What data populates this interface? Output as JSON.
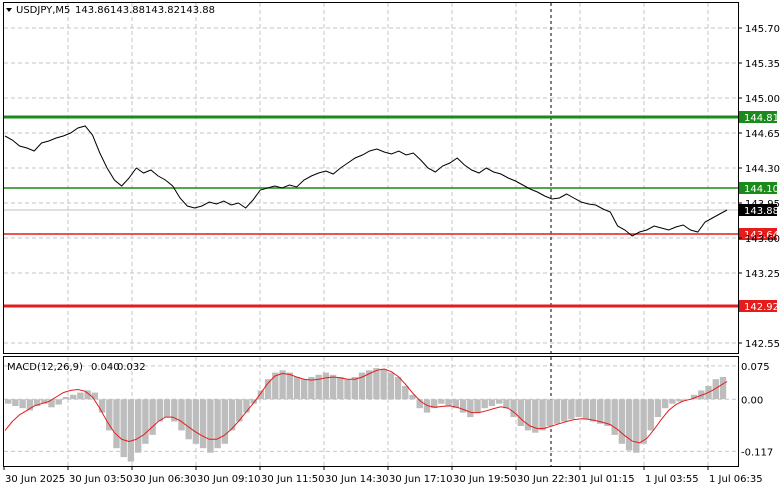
{
  "header": {
    "symbol": "USDJPY,M5",
    "open": "143.86",
    "high": "143.88",
    "low": "143.82",
    "close": "143.88"
  },
  "macd_header": {
    "label": "MACD(12,26,9)",
    "main": "0.040",
    "signal": "0.032"
  },
  "chart_data": [
    {
      "type": "line",
      "name": "price",
      "ylim": [
        142.45,
        145.95
      ],
      "y_ticks": [
        "145.70",
        "145.35",
        "145.00",
        "144.65",
        "144.30",
        "143.95",
        "143.60",
        "143.25",
        "142.55"
      ],
      "x_ticks": [
        "30 Jun 2025",
        "30 Jun 03:50",
        "30 Jun 06:30",
        "30 Jun 09:10",
        "30 Jun 11:50",
        "30 Jun 14:30",
        "30 Jun 17:10",
        "30 Jun 19:50",
        "30 Jun 22:30",
        "1 Jul 01:15",
        "1 Jul 03:55",
        "1 Jul 06:35"
      ],
      "values": [
        144.62,
        144.58,
        144.52,
        144.5,
        144.47,
        144.55,
        144.57,
        144.6,
        144.62,
        144.65,
        144.7,
        144.72,
        144.63,
        144.45,
        144.3,
        144.18,
        144.12,
        144.2,
        144.3,
        144.25,
        144.28,
        144.22,
        144.18,
        144.12,
        144.0,
        143.92,
        143.9,
        143.92,
        143.96,
        143.94,
        143.97,
        143.93,
        143.95,
        143.9,
        143.98,
        144.08,
        144.1,
        144.12,
        144.1,
        144.13,
        144.11,
        144.18,
        144.22,
        144.25,
        144.27,
        144.24,
        144.3,
        144.35,
        144.4,
        144.43,
        144.47,
        144.49,
        144.46,
        144.44,
        144.47,
        144.43,
        144.45,
        144.38,
        144.3,
        144.26,
        144.32,
        144.35,
        144.4,
        144.33,
        144.28,
        144.25,
        144.3,
        144.26,
        144.24,
        144.2,
        144.17,
        144.13,
        144.09,
        144.06,
        144.02,
        143.99,
        144.0,
        144.04,
        144.0,
        143.96,
        143.94,
        143.93,
        143.89,
        143.86,
        143.72,
        143.68,
        143.62,
        143.66,
        143.68,
        143.72,
        143.7,
        143.68,
        143.71,
        143.73,
        143.68,
        143.66,
        143.76,
        143.8,
        143.84,
        143.88
      ],
      "hlines": [
        {
          "label": "144.81",
          "value": 144.81,
          "color": "#1a8a1a",
          "width": 3
        },
        {
          "label": "144.10",
          "value": 144.1,
          "color": "#1a8a1a",
          "width": 1.5
        },
        {
          "label": "143.64",
          "value": 143.64,
          "color": "#e31c1c",
          "width": 1.5
        },
        {
          "label": "142.92",
          "value": 142.92,
          "color": "#e31c1c",
          "width": 3
        }
      ],
      "current": {
        "label": "143.88",
        "value": 143.88
      }
    },
    {
      "type": "bar",
      "name": "MACD(12,26,9)",
      "ylim": [
        -0.15,
        0.095
      ],
      "y_ticks": [
        "0.075",
        "0.00",
        "-0.117"
      ],
      "histogram": [
        -0.01,
        -0.015,
        -0.02,
        -0.025,
        -0.015,
        -0.01,
        -0.018,
        -0.012,
        0.005,
        0.01,
        0.015,
        0.02,
        0.015,
        -0.03,
        -0.07,
        -0.11,
        -0.13,
        -0.14,
        -0.12,
        -0.1,
        -0.08,
        -0.05,
        -0.04,
        -0.05,
        -0.07,
        -0.09,
        -0.1,
        -0.11,
        -0.12,
        -0.11,
        -0.1,
        -0.07,
        -0.05,
        -0.03,
        -0.01,
        0.02,
        0.045,
        0.06,
        0.065,
        0.06,
        0.05,
        0.045,
        0.05,
        0.055,
        0.06,
        0.055,
        0.05,
        0.045,
        0.05,
        0.06,
        0.065,
        0.07,
        0.068,
        0.06,
        0.05,
        0.03,
        0.01,
        -0.02,
        -0.03,
        -0.02,
        -0.01,
        -0.015,
        -0.02,
        -0.03,
        -0.04,
        -0.03,
        -0.02,
        -0.015,
        -0.01,
        -0.02,
        -0.04,
        -0.06,
        -0.07,
        -0.075,
        -0.07,
        -0.06,
        -0.055,
        -0.05,
        -0.045,
        -0.04,
        -0.045,
        -0.05,
        -0.055,
        -0.06,
        -0.08,
        -0.1,
        -0.115,
        -0.12,
        -0.1,
        -0.07,
        -0.04,
        -0.02,
        -0.01,
        -0.005,
        0.0,
        0.01,
        0.02,
        0.03,
        0.045,
        0.05
      ],
      "signal": [
        -0.07,
        -0.05,
        -0.035,
        -0.025,
        -0.015,
        -0.01,
        -0.005,
        0.005,
        0.015,
        0.02,
        0.022,
        0.018,
        0.005,
        -0.02,
        -0.05,
        -0.075,
        -0.09,
        -0.095,
        -0.09,
        -0.08,
        -0.065,
        -0.05,
        -0.04,
        -0.04,
        -0.048,
        -0.06,
        -0.072,
        -0.082,
        -0.09,
        -0.09,
        -0.082,
        -0.068,
        -0.05,
        -0.03,
        -0.01,
        0.012,
        0.035,
        0.052,
        0.058,
        0.056,
        0.05,
        0.045,
        0.043,
        0.045,
        0.048,
        0.05,
        0.048,
        0.045,
        0.045,
        0.05,
        0.058,
        0.065,
        0.068,
        0.062,
        0.05,
        0.032,
        0.012,
        -0.005,
        -0.015,
        -0.018,
        -0.016,
        -0.015,
        -0.018,
        -0.024,
        -0.03,
        -0.03,
        -0.026,
        -0.021,
        -0.017,
        -0.02,
        -0.032,
        -0.048,
        -0.06,
        -0.066,
        -0.065,
        -0.06,
        -0.055,
        -0.05,
        -0.046,
        -0.044,
        -0.045,
        -0.048,
        -0.052,
        -0.057,
        -0.068,
        -0.082,
        -0.094,
        -0.098,
        -0.088,
        -0.068,
        -0.045,
        -0.025,
        -0.012,
        -0.004,
        0.0,
        0.006,
        0.012,
        0.02,
        0.03,
        0.04
      ],
      "current": {
        "label": "0.040",
        "value": 0.04
      }
    }
  ],
  "colors": {
    "grid": "#c6c6c6",
    "price_line": "#000000",
    "histogram": "#bdbdbd",
    "signal": "#e31c1c",
    "support_green": "#1a8a1a",
    "resistance_red": "#e31c1c"
  }
}
